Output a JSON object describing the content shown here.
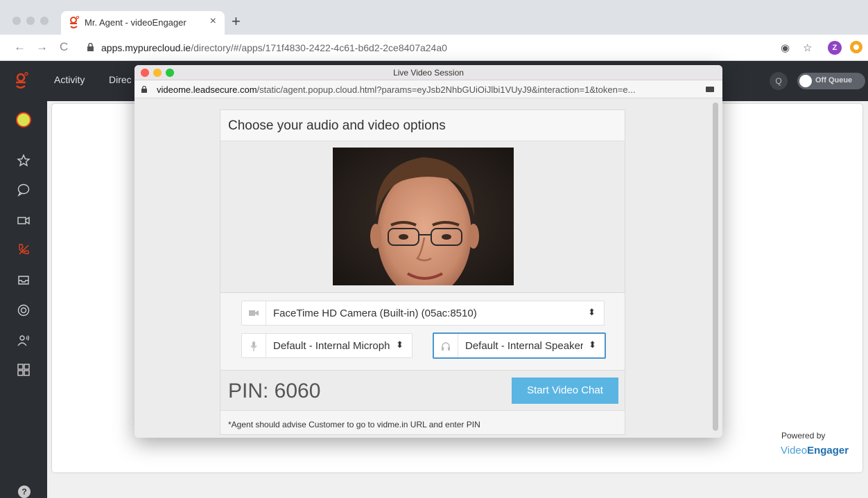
{
  "browser": {
    "tab_title": "Mr. Agent - videoEngager",
    "tab_close": "×",
    "new_tab": "+",
    "back": "←",
    "forward": "→",
    "reload": "C",
    "url_host": "apps.mypurecloud.ie",
    "url_path": "/directory/#/apps/171f4830-2422-4c61-b6d2-2ce8407a24a0",
    "star": "☆",
    "location_icon": "◉",
    "profile_initial": "Z",
    "colors": {
      "profile": "#8e44c4",
      "extension": "#f5a623"
    }
  },
  "app": {
    "nav": [
      "Activity",
      "Direc"
    ],
    "status_toggle": "Off Queue",
    "search_icon": "Q",
    "help_icon": "?",
    "sidebar_icons": [
      "avatar",
      "star-icon",
      "chat-icon",
      "video-icon",
      "phone-icon",
      "inbox-icon",
      "target-icon",
      "people-icon",
      "apps-icon"
    ],
    "powered_by": "Powered by",
    "brand_light": "Video",
    "brand_bold": "Engager",
    "colors": {
      "accent": "#e0401f",
      "bar": "#2b2e33"
    }
  },
  "popup": {
    "window_title": "Live Video Session",
    "url_host": "videome.leadsecure.com",
    "url_path": "/static/agent.popup.cloud.html?params=eyJsb2NhbGUiOiJlbi1VUyJ9&interaction=1&token=e..."
  },
  "dialog": {
    "title": "Choose your audio and video options",
    "camera_select": "FaceTime HD Camera (Built-in) (05ac:8510)",
    "microphone_select": "Default - Internal Microph",
    "speaker_select": "Default - Internal Speaker",
    "select_arrow": "⬍",
    "pin": "PIN: 6060",
    "start_button": "Start Video Chat",
    "note": "*Agent should advise Customer to go to vidme.in URL and enter PIN",
    "colors": {
      "button": "#5bb5e3",
      "active_border": "#4a95cf"
    }
  }
}
